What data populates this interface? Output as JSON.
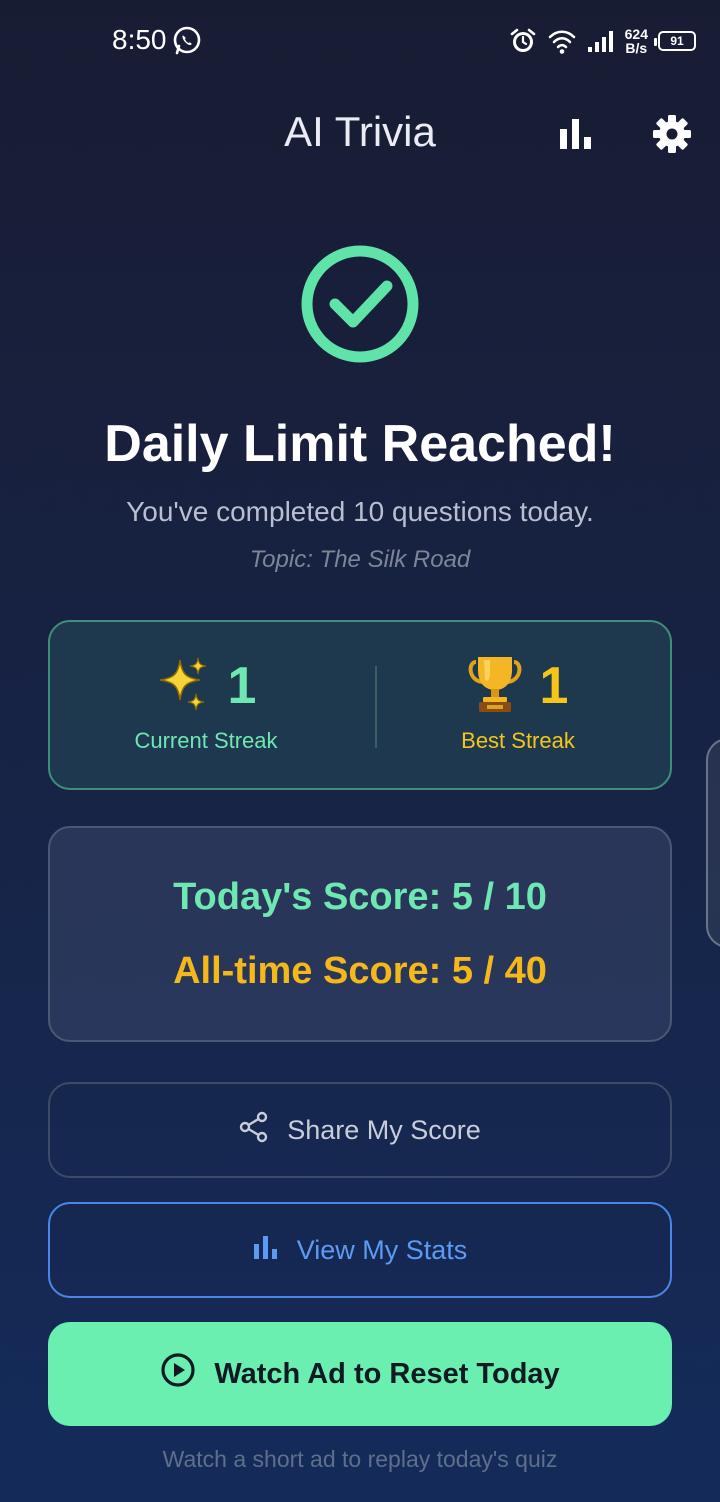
{
  "status_bar": {
    "time": "8:50",
    "net_speed_value": "624",
    "net_speed_unit": "B/s",
    "battery": "91"
  },
  "app_bar": {
    "title": "AI Trivia"
  },
  "hero": {
    "headline": "Daily Limit Reached!",
    "subline": "You've completed 10 questions today.",
    "topic": "Topic: The Silk Road"
  },
  "streaks": {
    "current": {
      "emoji": "✨",
      "value": "1",
      "label": "Current Streak"
    },
    "best": {
      "emoji": "🏆",
      "value": "1",
      "label": "Best Streak"
    }
  },
  "scores": {
    "today": "Today's Score: 5 / 10",
    "all_time": "All-time Score: 5 / 40"
  },
  "actions": {
    "share_label": "Share My Score",
    "stats_label": "View My Stats",
    "watch_label": "Watch Ad to Reset Today",
    "footnote": "Watch a short ad to replay today's quiz"
  },
  "colors": {
    "accent_green": "#6ee7b2",
    "accent_yellow": "#f5c518",
    "accent_blue": "#4a86e8",
    "cta_green": "#6aefb0"
  }
}
